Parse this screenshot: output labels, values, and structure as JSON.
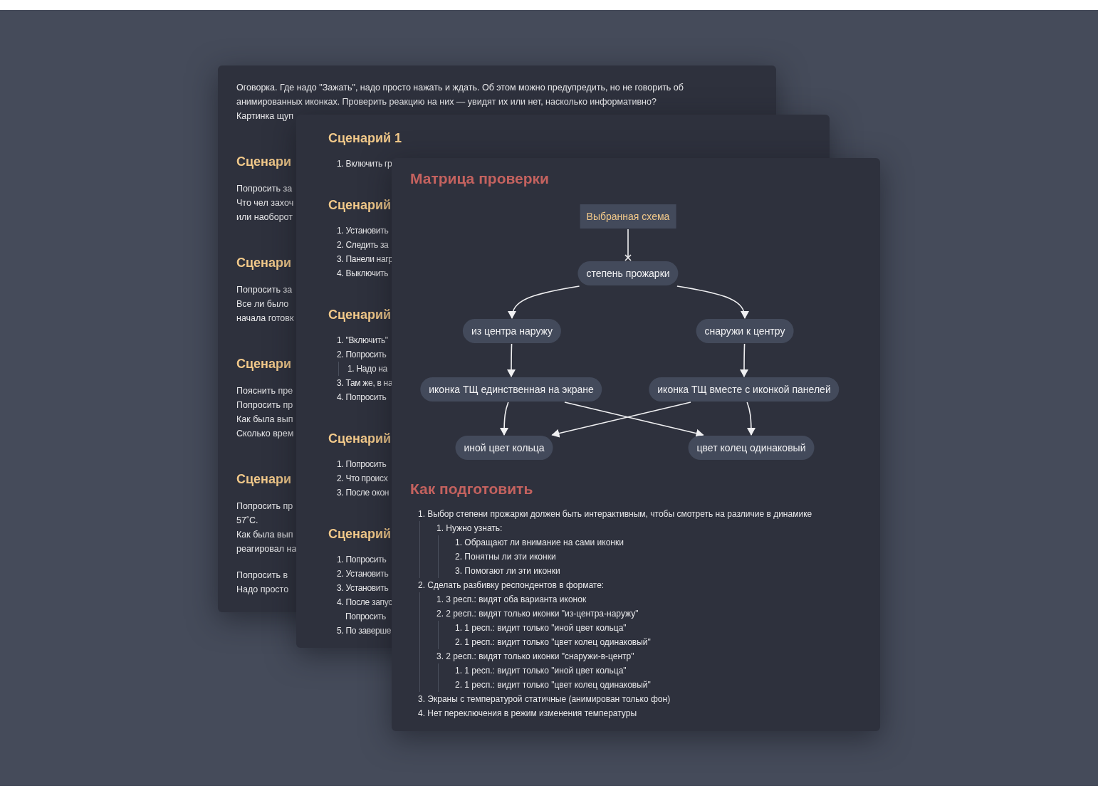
{
  "cards": [
    {
      "kind": "prose",
      "intro": [
        "Оговорка. Где надо \"Зажать\", надо просто нажать и ждать. Об этом можно предупредить, но не говорить об",
        "анимированных иконках. Проверить реакцию на них — увидят их или нет, насколько информативно?",
        "Картинка щуп"
      ],
      "sections": [
        {
          "heading": "Сценари",
          "paragraphs": [
            [
              "Попросить за",
              "Что чел захоч",
              "или наоборот"
            ]
          ]
        },
        {
          "heading": "Сценари",
          "paragraphs": [
            [
              "Попросить за",
              "Все ли было",
              "начала готовк"
            ]
          ]
        },
        {
          "heading": "Сценари",
          "paragraphs": [
            [
              "Пояснить пре",
              "Попросить пр",
              "Как была вып",
              "Сколько врем"
            ]
          ]
        },
        {
          "heading": "Сценари",
          "paragraphs": [
            [
              "Попросить пр",
              "57˚С.",
              "Как была вып",
              "реагировал на"
            ],
            [
              "Попросить в",
              "Надо просто"
            ]
          ]
        }
      ]
    },
    {
      "kind": "lists",
      "sections": [
        {
          "heading": "Сценарий 1",
          "items": [
            {
              "text": "1. Включить гр"
            }
          ]
        },
        {
          "heading": "Сценарий",
          "items": [
            {
              "text": "1. Установить"
            },
            {
              "text": "2. Следить за"
            },
            {
              "text": "3. Панели нагр"
            },
            {
              "text": "4. Выключить"
            }
          ]
        },
        {
          "heading": "Сценарий",
          "items": [
            {
              "text": "1. \"Включить\""
            },
            {
              "text": "2. Попросить",
              "children": [
                {
                  "text": "1. Надо на"
                }
              ]
            },
            {
              "text": "3. Там же, в на"
            },
            {
              "text": "4. Попросить"
            }
          ]
        },
        {
          "heading": "Сценарий",
          "items": [
            {
              "text": "1. Попросить"
            },
            {
              "text": "2. Что происх"
            },
            {
              "text": "3. После окон"
            }
          ]
        },
        {
          "heading": "Сценарий",
          "items": [
            {
              "text": "1. Попросить"
            },
            {
              "text": "2. Установить"
            },
            {
              "text": "3. Установить"
            },
            {
              "text": "4. После запус",
              "wrapped_line": "Попросить"
            },
            {
              "text": "5. По заверше"
            }
          ]
        }
      ]
    },
    {
      "kind": "matrix",
      "title": "Матрица проверки",
      "diagram": {
        "nodes": [
          {
            "label": "Выбранная схема",
            "kind": "box"
          },
          {
            "label": "степень прожарки",
            "kind": "pill"
          },
          {
            "label": "из центра наружу",
            "kind": "pill"
          },
          {
            "label": "снаружи к центру",
            "kind": "pill"
          },
          {
            "label": "иконка ТЩ единственная на экране",
            "kind": "pill"
          },
          {
            "label": "иконка ТЩ вместе с иконкой панелей",
            "kind": "pill"
          },
          {
            "label": "иной цвет кольца",
            "kind": "pill"
          },
          {
            "label": "цвет колец одинаковый",
            "kind": "pill"
          }
        ]
      },
      "subtitle": "Как подготовить",
      "outline": [
        {
          "text": "1. Выбор степени прожарки должен быть интерактивным, чтобы смотреть на различие в динамике",
          "children": [
            {
              "text": "1. Нужно узнать:",
              "children": [
                {
                  "text": "1. Обращают ли внимание на сами иконки"
                },
                {
                  "text": "2. Понятны ли эти иконки"
                },
                {
                  "text": "3. Помогают ли эти иконки"
                }
              ]
            }
          ]
        },
        {
          "text": "2. Сделать разбивку респондентов в формате:",
          "children": [
            {
              "text": "1. 3 респ.: видят оба варианта иконок"
            },
            {
              "text": "2. 2 респ.: видят только иконки \"из-центра-наружу\"",
              "children": [
                {
                  "text": "1. 1 респ.: видит только \"иной цвет кольца\""
                },
                {
                  "text": "2. 1 респ.: видит только \"цвет колец одинаковый\""
                }
              ]
            },
            {
              "text": "3. 2 респ.: видят только иконки \"снаружи-в-центр\"",
              "children": [
                {
                  "text": "1. 1 респ.: видит только \"иной цвет кольца\""
                },
                {
                  "text": "2. 1 респ.: видит только \"цвет колец одинаковый\""
                }
              ]
            }
          ]
        },
        {
          "text": "3. Экраны с температурой статичные (анимирован только фон)"
        },
        {
          "text": "4. Нет переключения в режим изменения температуры"
        }
      ]
    }
  ]
}
